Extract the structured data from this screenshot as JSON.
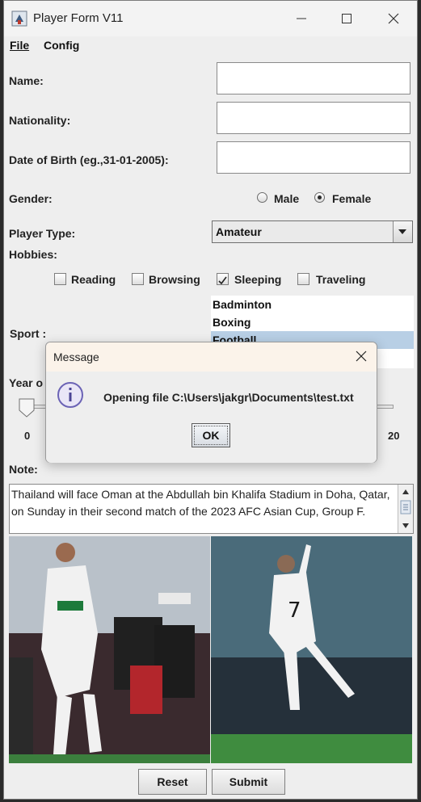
{
  "window": {
    "title": "Player Form V11"
  },
  "menu": {
    "file": "File",
    "config": "Config"
  },
  "form": {
    "name_label": "Name:",
    "name_value": "",
    "nationality_label": "Nationality:",
    "nationality_value": "",
    "dob_label": "Date of Birth (eg.,31-01-2005):",
    "dob_value": "",
    "gender_label": "Gender:",
    "gender_options": [
      {
        "label": "Male",
        "selected": false
      },
      {
        "label": "Female",
        "selected": true
      }
    ],
    "player_type_label": "Player Type:",
    "player_type_value": "Amateur",
    "hobbies_label": "Hobbies:",
    "hobbies": [
      {
        "label": "Reading",
        "checked": false
      },
      {
        "label": "Browsing",
        "checked": false
      },
      {
        "label": "Sleeping",
        "checked": true
      },
      {
        "label": "Traveling",
        "checked": false
      }
    ],
    "sport_label": "Sport :",
    "sports": [
      "Badminton",
      "Boxing",
      "Football"
    ],
    "sport_selected": "Football",
    "year_label": "Year o",
    "slider": {
      "min_label": "0",
      "max_label": "20",
      "value": 0
    },
    "note_label": "Note:",
    "note_value": "Thailand will face Oman at the Abdullah bin Khalifa Stadium in Doha, Qatar, on Sunday in their second match of the 2023 AFC Asian Cup, Group F."
  },
  "buttons": {
    "reset": "Reset",
    "submit": "Submit"
  },
  "dialog": {
    "title": "Message",
    "message": "Opening file C:\\Users\\jakgr\\Documents\\test.txt",
    "ok": "OK",
    "icon": "info-icon"
  },
  "colors": {
    "selection": "#b8cfe5",
    "window_bg": "#eeeeee",
    "dialog_title_bg": "#fbf3ea"
  }
}
